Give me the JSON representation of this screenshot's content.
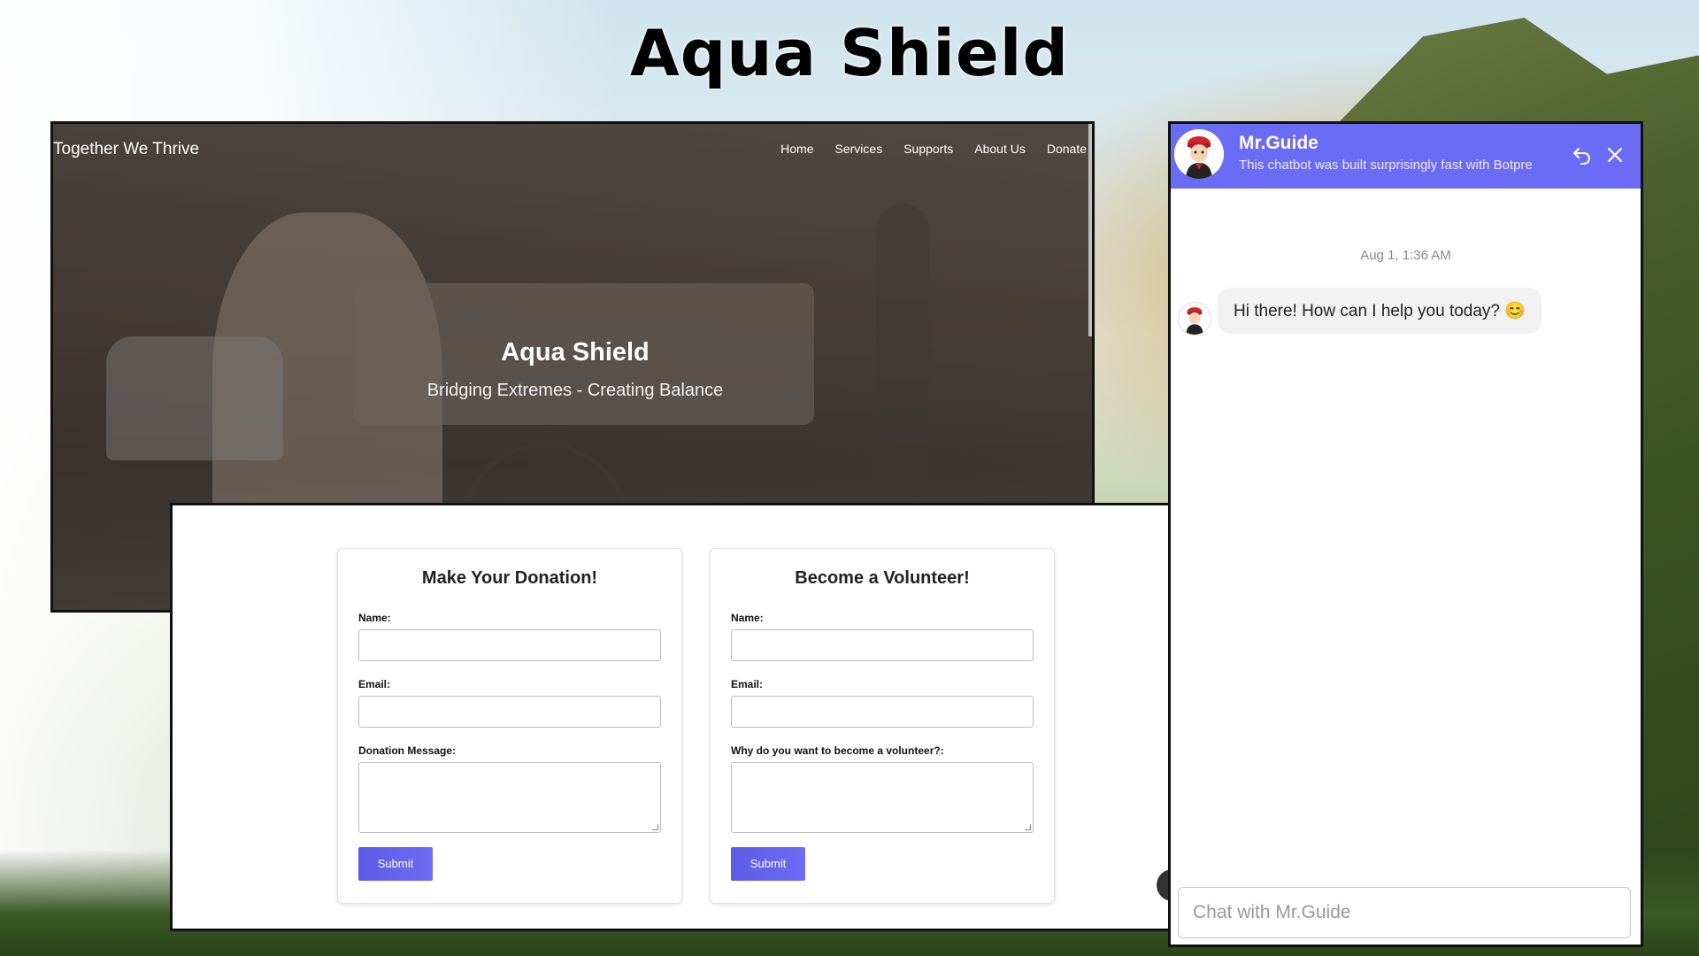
{
  "main_title": "Aqua Shield",
  "site": {
    "brand": "Together We Thrive",
    "nav": [
      "Home",
      "Services",
      "Supports",
      "About Us",
      "Donate"
    ],
    "hero_title": "Aqua Shield",
    "hero_subtitle": "Bridging Extremes - Creating Balance"
  },
  "donation_form": {
    "title": "Make Your Donation!",
    "name_label": "Name:",
    "email_label": "Email:",
    "message_label": "Donation Message:",
    "submit": "Submit"
  },
  "volunteer_form": {
    "title": "Become a Volunteer!",
    "name_label": "Name:",
    "email_label": "Email:",
    "message_label": "Why do you want to become a volunteer?:",
    "submit": "Submit"
  },
  "chat": {
    "bot_name": "Mr.Guide",
    "description": "This chatbot was built surprisingly fast with Botpre",
    "timestamp": "Aug 1, 1:36 AM",
    "bot_message": "Hi there! How can I help you today? 😊",
    "input_placeholder": "Chat with Mr.Guide",
    "header_color": "#6a6cf5"
  },
  "icons": {
    "restart": "restart-icon",
    "close": "close-icon"
  }
}
